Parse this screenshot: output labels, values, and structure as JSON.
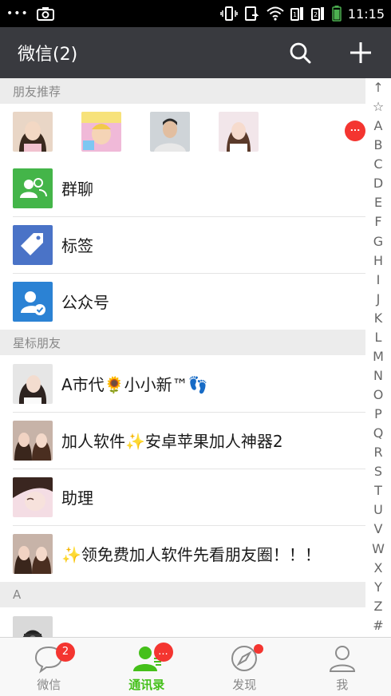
{
  "status_bar": {
    "dots": "•••",
    "time": "11:15"
  },
  "header": {
    "title": "微信(2)"
  },
  "sections": {
    "recommended": "朋友推荐",
    "starred": "星标朋友",
    "a": "A"
  },
  "recommended": {
    "more_badge": "..."
  },
  "functions": [
    {
      "label": "群聊",
      "icon": "group-chat-icon",
      "color": "#44b549"
    },
    {
      "label": "标签",
      "icon": "tag-icon",
      "color": "#4a73c7"
    },
    {
      "label": "公众号",
      "icon": "official-account-icon",
      "color": "#2b82d4"
    }
  ],
  "starred_friends": [
    {
      "name": "A市代🌻小小新™👣"
    },
    {
      "name": "加人软件✨安卓苹果加人神器2"
    },
    {
      "name": "助理"
    },
    {
      "name": "✨领免费加人软件先看朋友圈！！！"
    }
  ],
  "index": [
    "↑",
    "☆",
    "A",
    "B",
    "C",
    "D",
    "E",
    "F",
    "G",
    "H",
    "I",
    "J",
    "K",
    "L",
    "M",
    "N",
    "O",
    "P",
    "Q",
    "R",
    "S",
    "T",
    "U",
    "V",
    "W",
    "X",
    "Y",
    "Z",
    "#"
  ],
  "tabs": [
    {
      "label": "微信",
      "badge": "2",
      "icon": "chat-bubble-icon"
    },
    {
      "label": "通讯录",
      "badge": "...",
      "icon": "contacts-icon",
      "active": true
    },
    {
      "label": "发现",
      "badge": "",
      "icon": "compass-icon"
    },
    {
      "label": "我",
      "badge": "",
      "icon": "person-icon"
    }
  ],
  "colors": {
    "brand_green": "#45c01a",
    "appbar": "#393a3f",
    "badge_red": "#f43530"
  }
}
